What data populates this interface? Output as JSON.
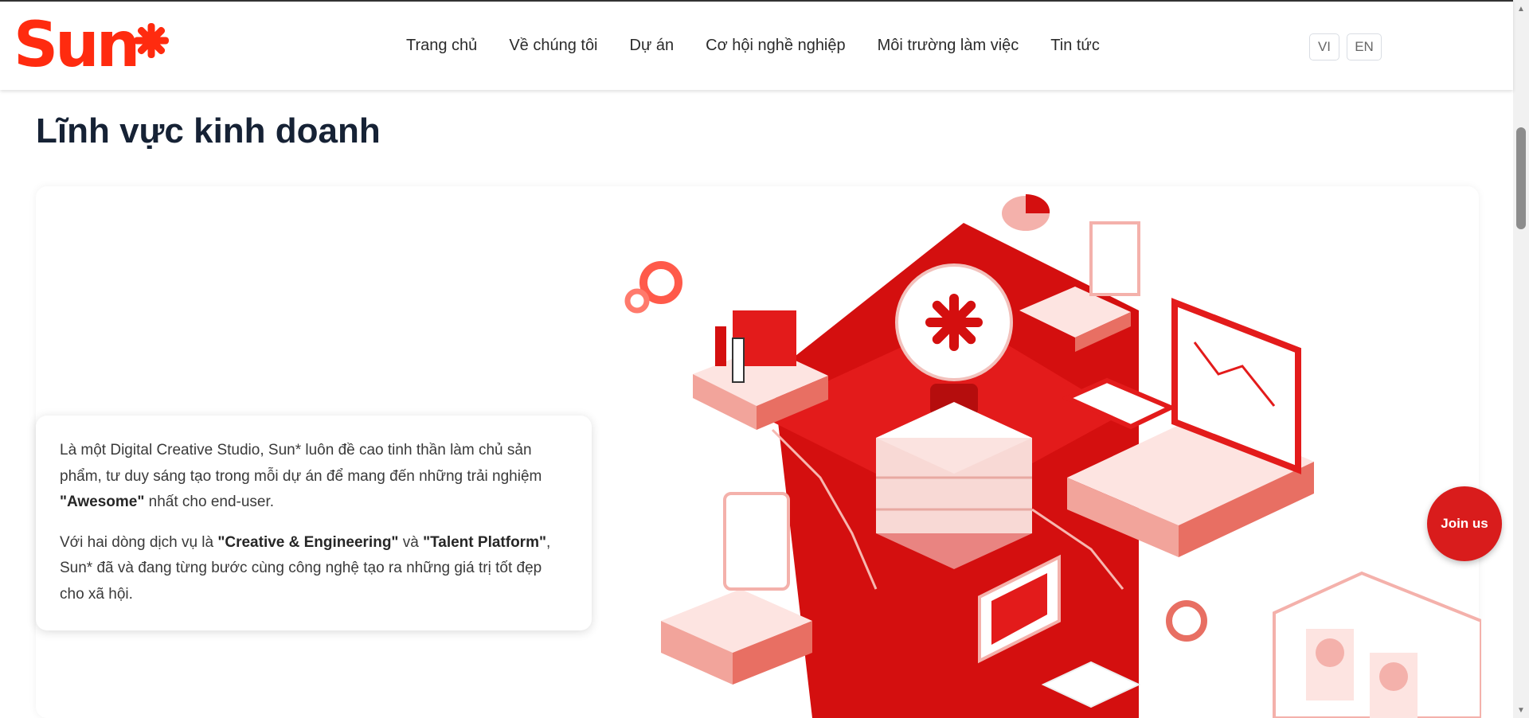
{
  "header": {
    "logo_text": "Sun",
    "logo_star": "*",
    "nav": [
      "Trang chủ",
      "Về chúng tôi",
      "Dự án",
      "Cơ hội nghề nghiệp",
      "Môi trường làm việc",
      "Tin tức"
    ],
    "languages": [
      "VI",
      "EN"
    ]
  },
  "main": {
    "title": "Lĩnh vực kinh doanh",
    "paragraph1": {
      "part1": "Là một Digital Creative Studio, Sun* luôn đề cao tinh thần làm chủ sản phẩm, tư duy sáng tạo trong mỗi dự án để mang đến những trải nghiệm ",
      "bold": "\"Awesome\"",
      "part2": " nhất cho end-user."
    },
    "paragraph2": {
      "part1": "Với hai dòng dịch vụ là ",
      "bold1": "\"Creative & Engineering\"",
      "part2": " và ",
      "bold2": "\"Talent Platform\"",
      "part3": ", Sun* đã và đang từng bước cùng công nghệ tạo ra những giá trị tốt đẹp cho xã hội."
    }
  },
  "join_button": "Join us",
  "colors": {
    "brand": "#ff2b0f",
    "red": "#d91c1c",
    "title": "#162235"
  },
  "icons": [
    "sun-star-logo-icon",
    "chevron-up-icon",
    "chevron-down-icon"
  ]
}
